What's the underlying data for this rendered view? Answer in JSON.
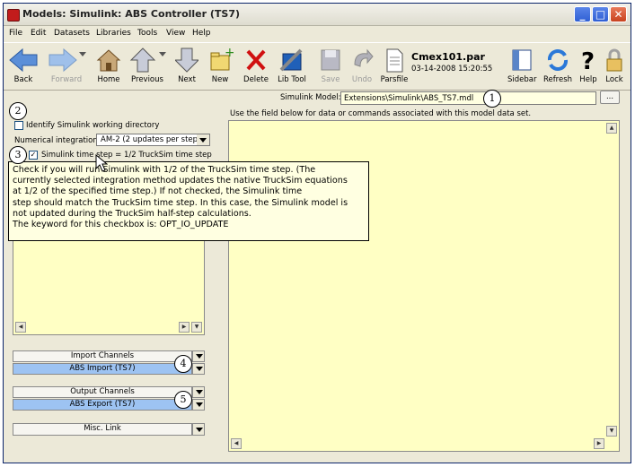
{
  "window": {
    "title": "Models: Simulink:  ABS Controller (TS7)"
  },
  "menu": [
    "File",
    "Edit",
    "Datasets",
    "Libraries",
    "Tools",
    "View",
    "Help"
  ],
  "toolbar": {
    "back": "Back",
    "forward": "Forward",
    "home": "Home",
    "previous": "Previous",
    "next": "Next",
    "new": "New",
    "delete": "Delete",
    "libtool": "Lib Tool",
    "save": "Save",
    "undo": "Undo",
    "parsfile": "Parsfile",
    "sidebar": "Sidebar",
    "refresh": "Refresh",
    "help": "Help",
    "lock": "Lock"
  },
  "parfile": {
    "name": "Cmex101.par",
    "date": "03-14-2008 15:20:55"
  },
  "model": {
    "label": "Simulink Model:",
    "value": "Extensions\\Simulink\\ABS_TS7.mdl",
    "browse": "...",
    "hint": "Use the field below  for data or commands associated with this model data set."
  },
  "options": {
    "working_dir": "Identify Simulink working directory",
    "integration_label": "Numerical integration:",
    "integration_value": "AM-2 (2 updates per step)",
    "timestep": "Simulink time step = 1/2 TruckSim time step"
  },
  "tooltip": {
    "lines": [
      "Check if you will run Simulink with 1/2 of the TruckSim time step. (The",
      "currently selected integration method updates the native TruckSim equations",
      "at 1/2 of the specified time step.) If not checked, the Simulink time",
      "step should match the TruckSim time step. In this case, the Simulink model is",
      "not updated during the TruckSim half-step calculations.",
      "The keyword for this checkbox is: OPT_IO_UPDATE"
    ]
  },
  "channels": {
    "import_label": "Import Channels",
    "import_value": "ABS Import (TS7)",
    "output_label": "Output Channels",
    "output_value": "ABS Export (TS7)",
    "misc": "Misc. Link"
  },
  "callouts": [
    "1",
    "2",
    "3",
    "4",
    "5"
  ],
  "colors": {
    "field_bg": "#ffffe1",
    "textarea_bg": "#ffffc4",
    "selected_bg": "#9dc3f2",
    "title_bar": "#e8e7de"
  }
}
